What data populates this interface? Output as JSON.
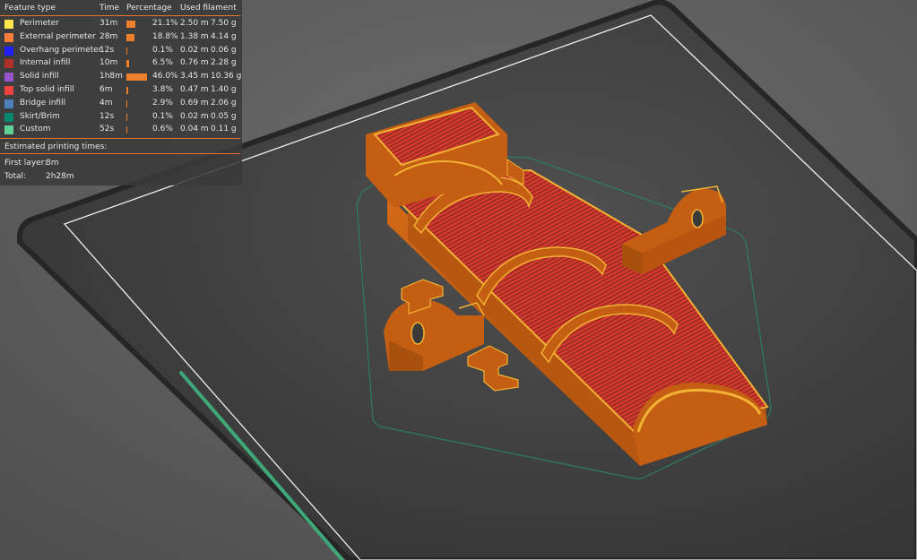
{
  "legend": {
    "headers": {
      "feature_type": "Feature type",
      "time": "Time",
      "percentage": "Percentage",
      "used_filament": "Used filament"
    },
    "rows": [
      {
        "label": "Perimeter",
        "time": "31m",
        "percent": "21.1%",
        "share": 0.211,
        "length": "2.50 m",
        "weight": "7.50 g",
        "color": "#ffe64d"
      },
      {
        "label": "External perimeter",
        "time": "28m",
        "percent": "18.8%",
        "share": 0.188,
        "length": "1.38 m",
        "weight": "4.14 g",
        "color": "#ff7d38"
      },
      {
        "label": "Overhang perimeter",
        "time": "12s",
        "percent": "0.1%",
        "share": 0.001,
        "length": "0.02 m",
        "weight": "0.06 g",
        "color": "#1f1fff"
      },
      {
        "label": "Internal infill",
        "time": "10m",
        "percent": "6.5%",
        "share": 0.065,
        "length": "0.76 m",
        "weight": "2.28 g",
        "color": "#b03029"
      },
      {
        "label": "Solid infill",
        "time": "1h8m",
        "percent": "46.0%",
        "share": 0.46,
        "length": "3.45 m",
        "weight": "10.36 g",
        "color": "#9654cc"
      },
      {
        "label": "Top solid infill",
        "time": "6m",
        "percent": "3.8%",
        "share": 0.038,
        "length": "0.47 m",
        "weight": "1.40 g",
        "color": "#f04040"
      },
      {
        "label": "Bridge infill",
        "time": "4m",
        "percent": "2.9%",
        "share": 0.029,
        "length": "0.69 m",
        "weight": "2.06 g",
        "color": "#4d80ba"
      },
      {
        "label": "Skirt/Brim",
        "time": "12s",
        "percent": "0.1%",
        "share": 0.001,
        "length": "0.02 m",
        "weight": "0.05 g",
        "color": "#00876e"
      },
      {
        "label": "Custom",
        "time": "52s",
        "percent": "0.6%",
        "share": 0.006,
        "length": "0.04 m",
        "weight": "0.11 g",
        "color": "#5ed194"
      }
    ],
    "estimated_label": "Estimated printing times:",
    "times": [
      {
        "label": "First layer:",
        "value": "8m"
      },
      {
        "label": "Total:",
        "value": "2h28m"
      }
    ]
  },
  "colors": {
    "background": "#5e5e5e",
    "bed": "#3a3a3a",
    "bed_border": "#232323",
    "bed_outline": "#f0f0f0",
    "skirt": "#2f7c66",
    "part_orange": "#c45e12",
    "part_infill": "#d63a2e",
    "part_edge": "#f2b233",
    "layer_slider": "#3fa878",
    "bar": "#ef7f2b"
  },
  "scene_icons": [
    "print-bed",
    "skirt-outline",
    "main-part",
    "bracket-part-right",
    "bracket-part-left",
    "clip-part-1",
    "clip-part-2",
    "layer-slider"
  ]
}
